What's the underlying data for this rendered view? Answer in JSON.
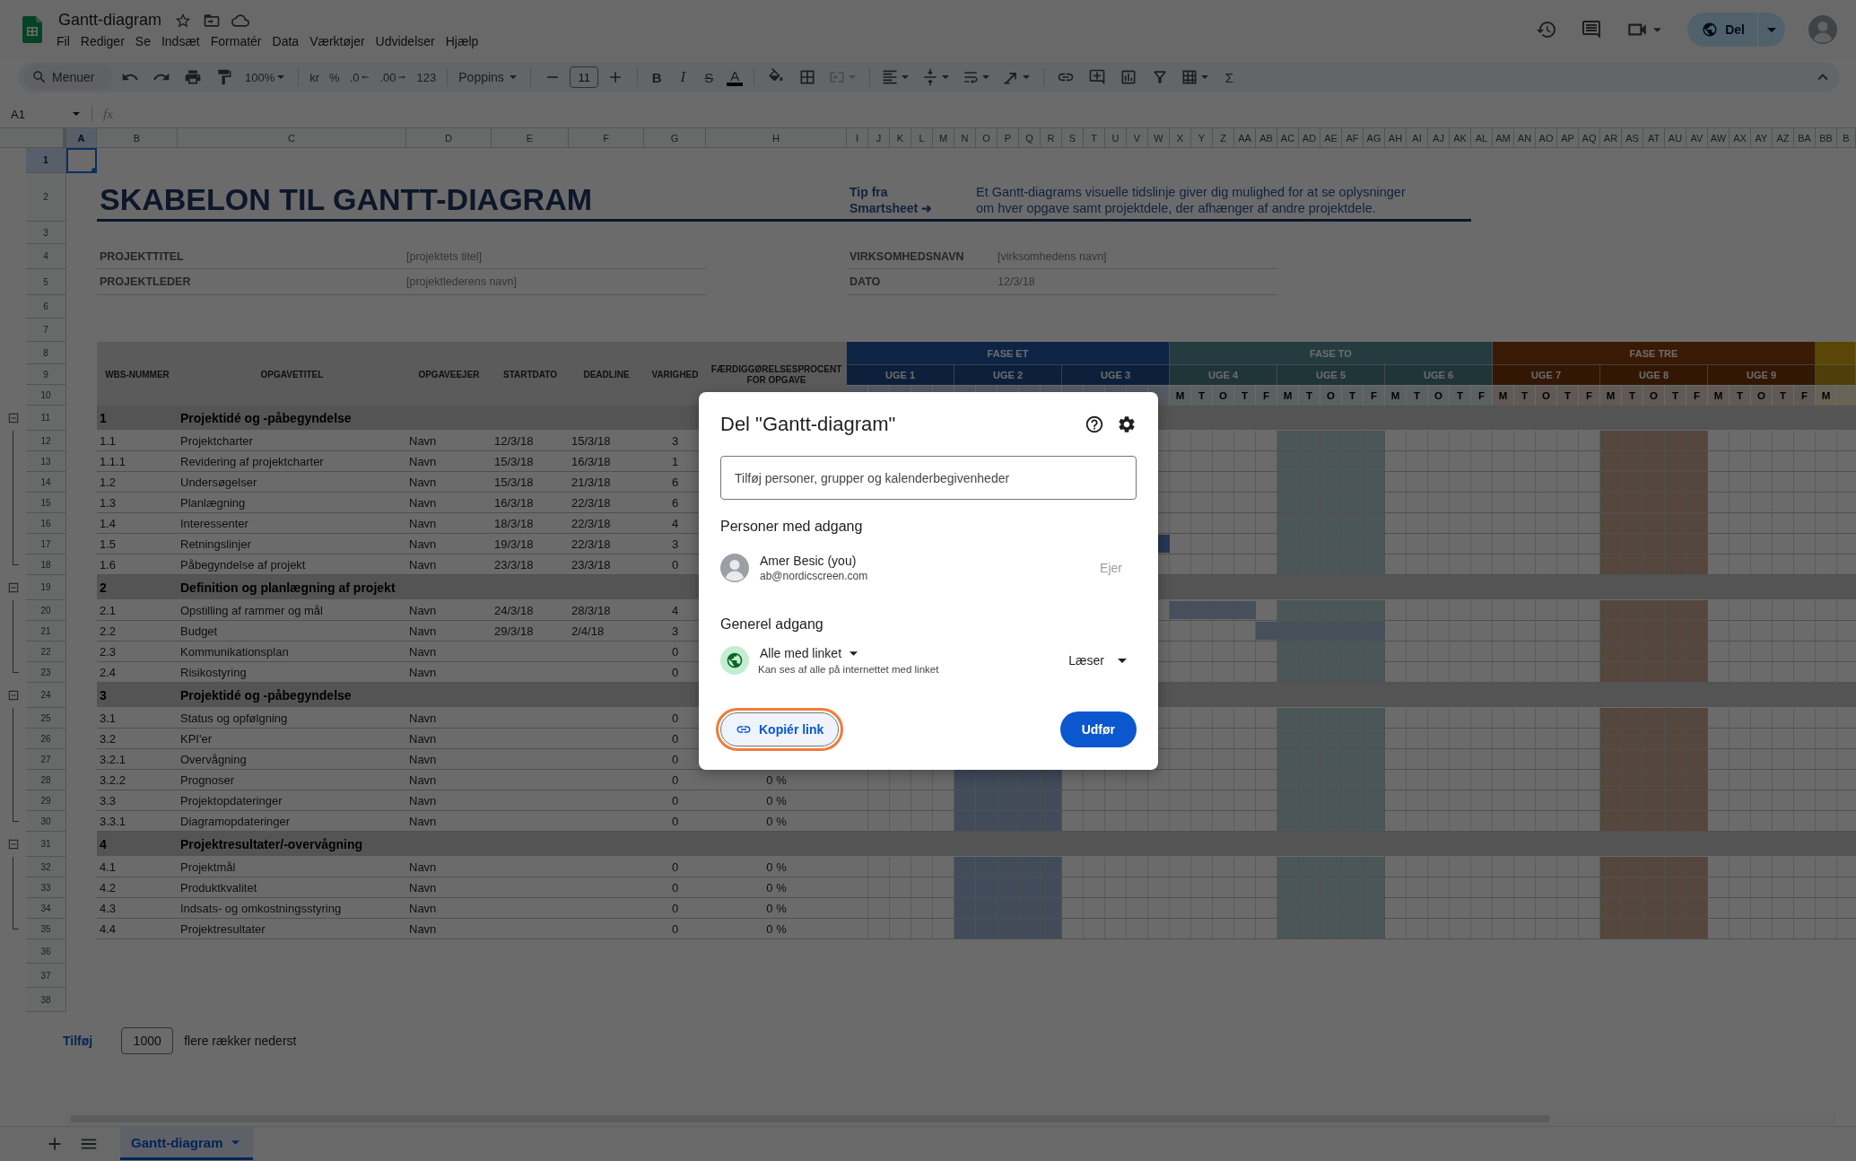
{
  "app": {
    "document_title": "Gantt-diagram",
    "menus": [
      "Fil",
      "Rediger",
      "Se",
      "Indsæt",
      "Formatér",
      "Data",
      "Værktøjer",
      "Udvidelser",
      "Hjælp"
    ],
    "share_button": "Del"
  },
  "toolbar": {
    "search": {
      "placeholder": "Menuer"
    },
    "zoom": "100%",
    "currency": "kr",
    "percent": "%",
    "decrease_decimals": ".0",
    "increase_decimals": ".00",
    "number_format": "123",
    "font": "Poppins",
    "font_size": "11",
    "bold": "B",
    "italic": "I",
    "strikethrough": "S",
    "text_color": "A",
    "merge_disabled": true,
    "functions": "Σ"
  },
  "formula_bar": {
    "cell_reference": "A1",
    "function_symbol": "fx"
  },
  "sheet": {
    "columns": [
      {
        "label": "A",
        "selected": true
      },
      {
        "label": "B",
        "selected": false
      },
      {
        "label": "C",
        "selected": false
      },
      {
        "label": "D",
        "selected": false
      },
      {
        "label": "E",
        "selected": false
      },
      {
        "label": "F",
        "selected": false
      },
      {
        "label": "G",
        "selected": false
      },
      {
        "label": "H",
        "selected": false
      },
      {
        "label": "I",
        "selected": false
      },
      {
        "label": "J",
        "selected": false
      },
      {
        "label": "K",
        "selected": false
      },
      {
        "label": "L",
        "selected": false
      },
      {
        "label": "M",
        "selected": false
      },
      {
        "label": "N",
        "selected": false
      },
      {
        "label": "O",
        "selected": false
      },
      {
        "label": "P",
        "selected": false
      },
      {
        "label": "Q",
        "selected": false
      },
      {
        "label": "R",
        "selected": false
      },
      {
        "label": "S",
        "selected": false
      },
      {
        "label": "T",
        "selected": false
      },
      {
        "label": "U",
        "selected": false
      },
      {
        "label": "V",
        "selected": false
      },
      {
        "label": "W",
        "selected": false
      },
      {
        "label": "X",
        "selected": false
      },
      {
        "label": "Y",
        "selected": false
      },
      {
        "label": "Z",
        "selected": false
      },
      {
        "label": "AA",
        "selected": false
      },
      {
        "label": "AB",
        "selected": false
      },
      {
        "label": "AC",
        "selected": false
      },
      {
        "label": "AD",
        "selected": false
      },
      {
        "label": "AE",
        "selected": false
      },
      {
        "label": "AF",
        "selected": false
      },
      {
        "label": "AG",
        "selected": false
      },
      {
        "label": "AH",
        "selected": false
      },
      {
        "label": "AI",
        "selected": false
      },
      {
        "label": "AJ",
        "selected": false
      },
      {
        "label": "AK",
        "selected": false
      },
      {
        "label": "AL",
        "selected": false
      },
      {
        "label": "AM",
        "selected": false
      },
      {
        "label": "AN",
        "selected": false
      },
      {
        "label": "AO",
        "selected": false
      },
      {
        "label": "AP",
        "selected": false
      },
      {
        "label": "AQ",
        "selected": false
      },
      {
        "label": "AR",
        "selected": false
      },
      {
        "label": "AS",
        "selected": false
      },
      {
        "label": "AT",
        "selected": false
      },
      {
        "label": "AU",
        "selected": false
      },
      {
        "label": "AV",
        "selected": false
      },
      {
        "label": "AW",
        "selected": false
      },
      {
        "label": "AX",
        "selected": false
      },
      {
        "label": "AY",
        "selected": false
      },
      {
        "label": "AZ",
        "selected": false
      },
      {
        "label": "BA",
        "selected": false
      },
      {
        "label": "BB",
        "selected": false
      },
      {
        "label": "B",
        "selected": false
      }
    ],
    "rows": [
      {
        "label": "1",
        "selected": true
      },
      {
        "label": "2",
        "selected": false
      },
      {
        "label": "3",
        "selected": false
      },
      {
        "label": "4",
        "selected": false
      },
      {
        "label": "5",
        "selected": false
      },
      {
        "label": "6",
        "selected": false
      },
      {
        "label": "7",
        "selected": false
      },
      {
        "label": "8",
        "selected": false
      },
      {
        "label": "9",
        "selected": false
      },
      {
        "label": "10",
        "selected": false
      },
      {
        "label": "11",
        "selected": false
      },
      {
        "label": "12",
        "selected": false
      },
      {
        "label": "13",
        "selected": false
      },
      {
        "label": "14",
        "selected": false
      },
      {
        "label": "15",
        "selected": false
      },
      {
        "label": "16",
        "selected": false
      },
      {
        "label": "17",
        "selected": false
      },
      {
        "label": "18",
        "selected": false
      },
      {
        "label": "19",
        "selected": false
      },
      {
        "label": "20",
        "selected": false
      },
      {
        "label": "21",
        "selected": false
      },
      {
        "label": "22",
        "selected": false
      },
      {
        "label": "23",
        "selected": false
      },
      {
        "label": "24",
        "selected": false
      },
      {
        "label": "25",
        "selected": false
      },
      {
        "label": "26",
        "selected": false
      },
      {
        "label": "27",
        "selected": false
      },
      {
        "label": "28",
        "selected": false
      },
      {
        "label": "29",
        "selected": false
      },
      {
        "label": "30",
        "selected": false
      },
      {
        "label": "31",
        "selected": false
      },
      {
        "label": "32",
        "selected": false
      },
      {
        "label": "33",
        "selected": false
      },
      {
        "label": "34",
        "selected": false
      },
      {
        "label": "35",
        "selected": false
      },
      {
        "label": "36",
        "selected": false
      },
      {
        "label": "37",
        "selected": false
      },
      {
        "label": "38",
        "selected": false
      }
    ],
    "title": "SKABELON TIL GANTT-DIAGRAM",
    "tip": {
      "label": "Tip fra Smartsheet ➜",
      "lines": [
        "Et Gantt-diagrams visuelle tidslinje giver dig mulighed for at se oplysninger",
        "om hver opgave samt projektdele, der afhænger af andre projektdele."
      ]
    },
    "project_info": [
      {
        "label": "PROJEKTTITEL",
        "value": "[projektets titel]"
      },
      {
        "label": "PROJEKTLEDER",
        "value": "[projektlederens navn]"
      }
    ],
    "company_info": [
      {
        "label": "VIRKSOMHEDSNAVN",
        "value": "[virksomhedens navn]"
      },
      {
        "label": "DATO",
        "value": "12/3/18"
      }
    ],
    "table_headers": [
      "WBS-NUMMER",
      "OPGAVETITEL",
      "OPGAVEEJER",
      "STARTDATO",
      "DEADLINE",
      "VARIGHED",
      "FÆRDIGGØRELSESPROCENT FOR OPGAVE"
    ],
    "timeline": {
      "phases": [
        {
          "name": "FASE ET",
          "color": "#0e2445",
          "weeks": [
            {
              "label": "UGE 1",
              "shaded": false
            },
            {
              "label": "UGE 2",
              "shaded": true
            },
            {
              "label": "UGE 3",
              "shaded": false
            }
          ]
        },
        {
          "name": "FASE TO",
          "color": "#243c40",
          "weeks": [
            {
              "label": "UGE 4",
              "shaded": false,
              "days": [
                "M",
                "T",
                "O",
                "T",
                "F"
              ]
            },
            {
              "label": "UGE 5",
              "shaded": true,
              "days": [
                "M",
                "T",
                "O",
                "T",
                "F"
              ]
            },
            {
              "label": "UGE 6",
              "shaded": false,
              "days": [
                "M",
                "T",
                "O",
                "T",
                "F"
              ]
            }
          ]
        },
        {
          "name": "FASE TRE",
          "color": "#3a1a06",
          "weeks": [
            {
              "label": "UGE 7",
              "shaded": false,
              "days": [
                "M",
                "T",
                "O",
                "T",
                "F"
              ]
            },
            {
              "label": "UGE 8",
              "shaded": true,
              "days": [
                "M",
                "T",
                "O",
                "T",
                "F"
              ]
            },
            {
              "label": "UGE 9",
              "shaded": false,
              "days": [
                "M",
                "T",
                "O",
                "T",
                "F"
              ]
            }
          ]
        },
        {
          "color": "#5a4708",
          "weeks": [
            {
              "shaded": false,
              "days": [
                "M"
              ]
            }
          ]
        }
      ]
    },
    "groups": [
      {
        "number": "1",
        "title": "Projektidé og -påbegyndelse",
        "tasks": [
          {
            "wbs": "1.1",
            "title": "Projektcharter",
            "owner": "Navn",
            "start": "12/3/18",
            "deadline": "15/3/18",
            "duration": "3"
          },
          {
            "wbs": "1.1.1",
            "title": "Revidering af projektcharter",
            "owner": "Navn",
            "start": "15/3/18",
            "deadline": "16/3/18",
            "duration": "1"
          },
          {
            "wbs": "1.2",
            "title": "Undersøgelser",
            "owner": "Navn",
            "start": "15/3/18",
            "deadline": "21/3/18",
            "duration": "6"
          },
          {
            "wbs": "1.3",
            "title": "Planlægning",
            "owner": "Navn",
            "start": "16/3/18",
            "deadline": "22/3/18",
            "duration": "6"
          },
          {
            "wbs": "1.4",
            "title": "Interessenter",
            "owner": "Navn",
            "start": "18/3/18",
            "deadline": "22/3/18",
            "duration": "4"
          },
          {
            "wbs": "1.5",
            "title": "Retningslinjer",
            "owner": "Navn",
            "start": "19/3/18",
            "deadline": "22/3/18",
            "duration": "3"
          },
          {
            "wbs": "1.6",
            "title": "Påbegyndelse af projekt",
            "owner": "Navn",
            "start": "23/3/18",
            "deadline": "23/3/18",
            "duration": "0"
          }
        ]
      },
      {
        "number": "2",
        "title": "Definition og planlægning af projekt",
        "tasks": [
          {
            "wbs": "2.1",
            "title": "Opstilling af rammer og mål",
            "owner": "Navn",
            "start": "24/3/18",
            "deadline": "28/3/18",
            "duration": "4"
          },
          {
            "wbs": "2.2",
            "title": "Budget",
            "owner": "Navn",
            "start": "29/3/18",
            "deadline": "2/4/18",
            "duration": "3"
          },
          {
            "wbs": "2.3",
            "title": "Kommunikationsplan",
            "owner": "Navn",
            "duration": "0"
          },
          {
            "wbs": "2.4",
            "title": "Risikostyring",
            "owner": "Navn",
            "duration": "0"
          }
        ]
      },
      {
        "number": "3",
        "title": "Projektidé og -påbegyndelse",
        "tasks": [
          {
            "wbs": "3.1",
            "title": "Status og opfølgning",
            "owner": "Navn",
            "duration": "0"
          },
          {
            "wbs": "3.2",
            "title": "KPI'er",
            "owner": "Navn",
            "duration": "0"
          },
          {
            "wbs": "3.2.1",
            "title": "Overvågning",
            "owner": "Navn",
            "duration": "0"
          },
          {
            "wbs": "3.2.2",
            "title": "Prognoser",
            "owner": "Navn",
            "duration": "0",
            "percent": "0 %"
          },
          {
            "wbs": "3.3",
            "title": "Projektopdateringer",
            "owner": "Navn",
            "duration": "0",
            "percent": "0 %"
          },
          {
            "wbs": "3.3.1",
            "title": "Diagramopdateringer",
            "owner": "Navn",
            "duration": "0",
            "percent": "0 %"
          }
        ]
      },
      {
        "number": "4",
        "title": "Projektresultater/-overvågning",
        "tasks": [
          {
            "wbs": "4.1",
            "title": "Projektmål",
            "owner": "Navn",
            "duration": "0",
            "percent": "0 %"
          },
          {
            "wbs": "4.2",
            "title": "Produktkvalitet",
            "owner": "Navn",
            "duration": "0",
            "percent": "0 %"
          },
          {
            "wbs": "4.3",
            "title": "Indsats- og omkostningsstyring",
            "owner": "Navn",
            "duration": "0",
            "percent": "0 %"
          },
          {
            "wbs": "4.4",
            "title": "Projektresultater",
            "owner": "Navn",
            "duration": "0",
            "percent": "0 %"
          }
        ]
      }
    ]
  },
  "add_rows": {
    "button": "Tilføj",
    "count": "1000",
    "suffix": "flere rækker nederst"
  },
  "sheet_tabs": [
    {
      "name": "Gantt-diagram",
      "selected": true
    }
  ],
  "share_dialog": {
    "title": "Del \"Gantt-diagram\"",
    "invite_field": {
      "placeholder": "Tilføj personer, grupper og kalenderbegivenheder"
    },
    "people_heading": "Personer med adgang",
    "people": [
      {
        "name": "Amer Besic (you)",
        "email": "ab@nordicscreen.com",
        "role": "Ejer"
      }
    ],
    "general_access_heading": "Generel adgang",
    "general_access": {
      "scope": "Alle med linket",
      "description": "Kan ses af alle på internettet med linket",
      "role": "Læser"
    },
    "copy_link": {
      "label": "Kopiér link",
      "focused": true
    },
    "done_button": "Udfør"
  }
}
